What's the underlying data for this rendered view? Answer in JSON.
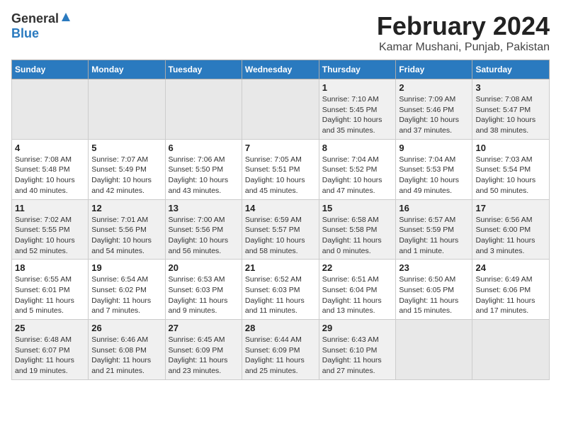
{
  "header": {
    "logo_general": "General",
    "logo_blue": "Blue",
    "month_title": "February 2024",
    "location": "Kamar Mushani, Punjab, Pakistan"
  },
  "days_of_week": [
    "Sunday",
    "Monday",
    "Tuesday",
    "Wednesday",
    "Thursday",
    "Friday",
    "Saturday"
  ],
  "weeks": [
    [
      {
        "day": "",
        "info": ""
      },
      {
        "day": "",
        "info": ""
      },
      {
        "day": "",
        "info": ""
      },
      {
        "day": "",
        "info": ""
      },
      {
        "day": "1",
        "info": "Sunrise: 7:10 AM\nSunset: 5:45 PM\nDaylight: 10 hours\nand 35 minutes."
      },
      {
        "day": "2",
        "info": "Sunrise: 7:09 AM\nSunset: 5:46 PM\nDaylight: 10 hours\nand 37 minutes."
      },
      {
        "day": "3",
        "info": "Sunrise: 7:08 AM\nSunset: 5:47 PM\nDaylight: 10 hours\nand 38 minutes."
      }
    ],
    [
      {
        "day": "4",
        "info": "Sunrise: 7:08 AM\nSunset: 5:48 PM\nDaylight: 10 hours\nand 40 minutes."
      },
      {
        "day": "5",
        "info": "Sunrise: 7:07 AM\nSunset: 5:49 PM\nDaylight: 10 hours\nand 42 minutes."
      },
      {
        "day": "6",
        "info": "Sunrise: 7:06 AM\nSunset: 5:50 PM\nDaylight: 10 hours\nand 43 minutes."
      },
      {
        "day": "7",
        "info": "Sunrise: 7:05 AM\nSunset: 5:51 PM\nDaylight: 10 hours\nand 45 minutes."
      },
      {
        "day": "8",
        "info": "Sunrise: 7:04 AM\nSunset: 5:52 PM\nDaylight: 10 hours\nand 47 minutes."
      },
      {
        "day": "9",
        "info": "Sunrise: 7:04 AM\nSunset: 5:53 PM\nDaylight: 10 hours\nand 49 minutes."
      },
      {
        "day": "10",
        "info": "Sunrise: 7:03 AM\nSunset: 5:54 PM\nDaylight: 10 hours\nand 50 minutes."
      }
    ],
    [
      {
        "day": "11",
        "info": "Sunrise: 7:02 AM\nSunset: 5:55 PM\nDaylight: 10 hours\nand 52 minutes."
      },
      {
        "day": "12",
        "info": "Sunrise: 7:01 AM\nSunset: 5:56 PM\nDaylight: 10 hours\nand 54 minutes."
      },
      {
        "day": "13",
        "info": "Sunrise: 7:00 AM\nSunset: 5:56 PM\nDaylight: 10 hours\nand 56 minutes."
      },
      {
        "day": "14",
        "info": "Sunrise: 6:59 AM\nSunset: 5:57 PM\nDaylight: 10 hours\nand 58 minutes."
      },
      {
        "day": "15",
        "info": "Sunrise: 6:58 AM\nSunset: 5:58 PM\nDaylight: 11 hours\nand 0 minutes."
      },
      {
        "day": "16",
        "info": "Sunrise: 6:57 AM\nSunset: 5:59 PM\nDaylight: 11 hours\nand 1 minute."
      },
      {
        "day": "17",
        "info": "Sunrise: 6:56 AM\nSunset: 6:00 PM\nDaylight: 11 hours\nand 3 minutes."
      }
    ],
    [
      {
        "day": "18",
        "info": "Sunrise: 6:55 AM\nSunset: 6:01 PM\nDaylight: 11 hours\nand 5 minutes."
      },
      {
        "day": "19",
        "info": "Sunrise: 6:54 AM\nSunset: 6:02 PM\nDaylight: 11 hours\nand 7 minutes."
      },
      {
        "day": "20",
        "info": "Sunrise: 6:53 AM\nSunset: 6:03 PM\nDaylight: 11 hours\nand 9 minutes."
      },
      {
        "day": "21",
        "info": "Sunrise: 6:52 AM\nSunset: 6:03 PM\nDaylight: 11 hours\nand 11 minutes."
      },
      {
        "day": "22",
        "info": "Sunrise: 6:51 AM\nSunset: 6:04 PM\nDaylight: 11 hours\nand 13 minutes."
      },
      {
        "day": "23",
        "info": "Sunrise: 6:50 AM\nSunset: 6:05 PM\nDaylight: 11 hours\nand 15 minutes."
      },
      {
        "day": "24",
        "info": "Sunrise: 6:49 AM\nSunset: 6:06 PM\nDaylight: 11 hours\nand 17 minutes."
      }
    ],
    [
      {
        "day": "25",
        "info": "Sunrise: 6:48 AM\nSunset: 6:07 PM\nDaylight: 11 hours\nand 19 minutes."
      },
      {
        "day": "26",
        "info": "Sunrise: 6:46 AM\nSunset: 6:08 PM\nDaylight: 11 hours\nand 21 minutes."
      },
      {
        "day": "27",
        "info": "Sunrise: 6:45 AM\nSunset: 6:09 PM\nDaylight: 11 hours\nand 23 minutes."
      },
      {
        "day": "28",
        "info": "Sunrise: 6:44 AM\nSunset: 6:09 PM\nDaylight: 11 hours\nand 25 minutes."
      },
      {
        "day": "29",
        "info": "Sunrise: 6:43 AM\nSunset: 6:10 PM\nDaylight: 11 hours\nand 27 minutes."
      },
      {
        "day": "",
        "info": ""
      },
      {
        "day": "",
        "info": ""
      }
    ]
  ]
}
